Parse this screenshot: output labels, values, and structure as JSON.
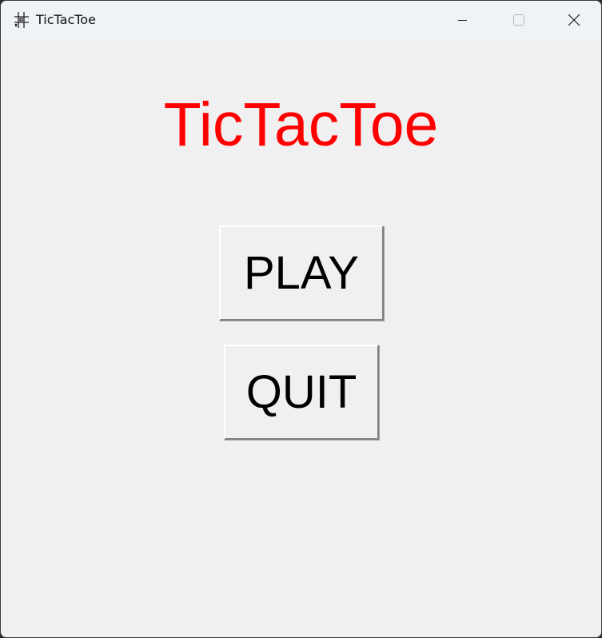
{
  "window": {
    "title": "TicTacToe",
    "icon": "hash-grid-icon",
    "controls": {
      "minimize": "minimize-icon",
      "maximize": "maximize-icon",
      "close": "close-icon"
    }
  },
  "main": {
    "title": "TicTacToe",
    "title_color": "#ff0000",
    "play_label": "PLAY",
    "quit_label": "QUIT"
  }
}
